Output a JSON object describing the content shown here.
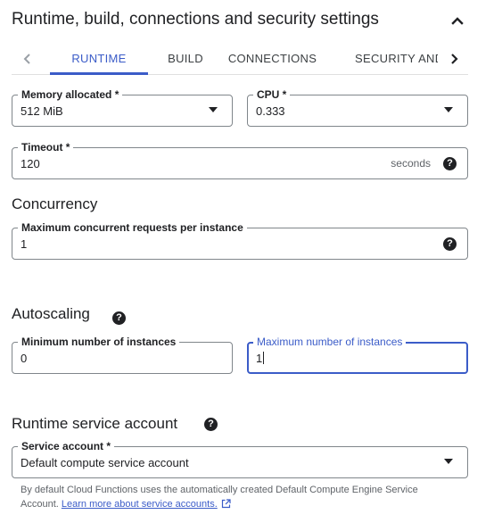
{
  "header": {
    "title": "Runtime, build, connections and security settings",
    "collapse_icon": "chevron-up-icon"
  },
  "tabs": {
    "items": [
      {
        "label": "RUNTIME",
        "active": true
      },
      {
        "label": "BUILD",
        "active": false
      },
      {
        "label": "CONNECTIONS",
        "active": false
      },
      {
        "label": "SECURITY AND",
        "active": false
      }
    ],
    "prev_icon": "chevron-left-icon",
    "next_icon": "chevron-right-icon",
    "accent_color": "#3b5cc8"
  },
  "runtime": {
    "memory": {
      "label": "Memory allocated *",
      "value": "512 MiB"
    },
    "cpu": {
      "label": "CPU *",
      "value": "0.333"
    },
    "timeout": {
      "label": "Timeout *",
      "value": "120",
      "suffix": "seconds"
    }
  },
  "concurrency": {
    "title": "Concurrency",
    "max_requests": {
      "label": "Maximum concurrent requests per instance",
      "value": "1"
    }
  },
  "autoscaling": {
    "title": "Autoscaling",
    "min_instances": {
      "label": "Minimum number of instances",
      "value": "0"
    },
    "max_instances": {
      "label": "Maximum number of instances",
      "value": "1"
    }
  },
  "service_account": {
    "title": "Runtime service account",
    "field": {
      "label": "Service account *",
      "value": "Default compute service account"
    },
    "hint_text": "By default Cloud Functions uses the automatically created Default Compute Engine Service Account.",
    "hint_link": "Learn more about service accounts."
  },
  "icons": {
    "help": "help-icon",
    "dropdown": "dropdown-arrow-icon",
    "external_link": "external-link-icon"
  }
}
